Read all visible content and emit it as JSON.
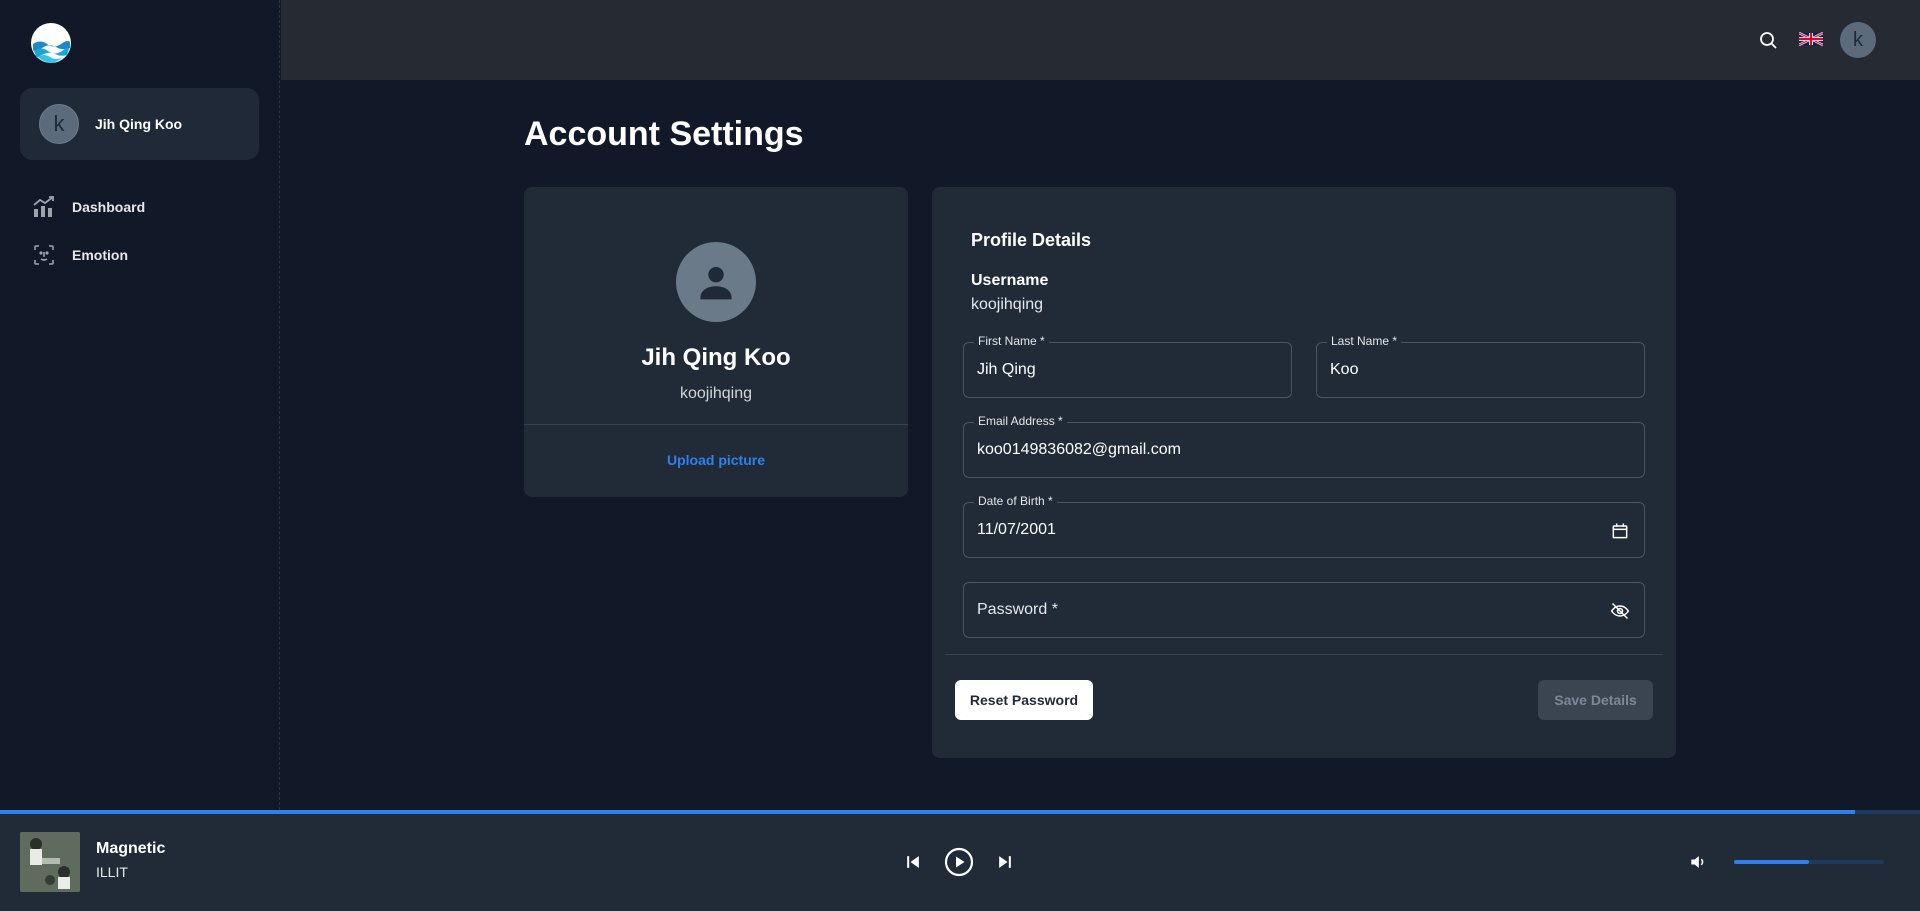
{
  "sidebar": {
    "user": {
      "avatar_letter": "k",
      "name": "Jih Qing Koo"
    },
    "items": [
      {
        "label": "Dashboard",
        "icon": "chart-trend-icon"
      },
      {
        "label": "Emotion",
        "icon": "face-scan-icon"
      }
    ]
  },
  "topbar": {
    "search_icon": "search-icon",
    "language_flag": "uk-flag-icon",
    "avatar_letter": "k"
  },
  "main": {
    "title": "Account Settings",
    "profile_card": {
      "name": "Jih Qing Koo",
      "username": "koojihqing",
      "upload_label": "Upload picture"
    },
    "details": {
      "title": "Profile Details",
      "username_label": "Username",
      "username_value": "koojihqing",
      "first_name": {
        "label": "First Name *",
        "value": "Jih Qing"
      },
      "last_name": {
        "label": "Last Name *",
        "value": "Koo"
      },
      "email": {
        "label": "Email Address *",
        "value": "koo0149836082@gmail.com"
      },
      "dob": {
        "label": "Date of Birth *",
        "value": "11/07/2001"
      },
      "password": {
        "label": "Password *"
      },
      "reset_label": "Reset Password",
      "save_label": "Save Details"
    }
  },
  "player": {
    "track_title": "Magnetic",
    "artist": "ILLIT",
    "progress": 0.966,
    "volume": 0.5
  },
  "colors": {
    "background": "#111827",
    "card": "#212b37",
    "accent": "#2f80ed",
    "topbar": "#252a33"
  }
}
